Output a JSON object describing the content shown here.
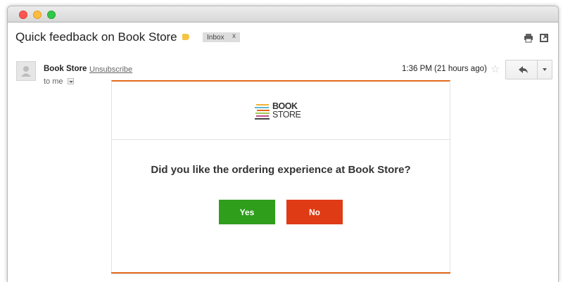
{
  "email": {
    "subject": "Quick feedback on Book Store",
    "label_chip": "Inbox",
    "label_chip_close": "x",
    "sender": "Book Store",
    "unsubscribe": "Unsubscribe",
    "to": "to me",
    "timestamp": "1:36 PM (21 hours ago)"
  },
  "card": {
    "logo_line1": "BOOK",
    "logo_line2": "STORE",
    "question": "Did you like the ordering experience at Book Store?",
    "yes_label": "Yes",
    "no_label": "No"
  },
  "colors": {
    "accent": "#e36b1c",
    "yes": "#2e9e1b",
    "no": "#df3b14",
    "label_tag": "#f5c542"
  },
  "icons": [
    "print-icon",
    "popout-icon",
    "star-icon",
    "reply-icon",
    "more-options-icon",
    "avatar-icon"
  ]
}
